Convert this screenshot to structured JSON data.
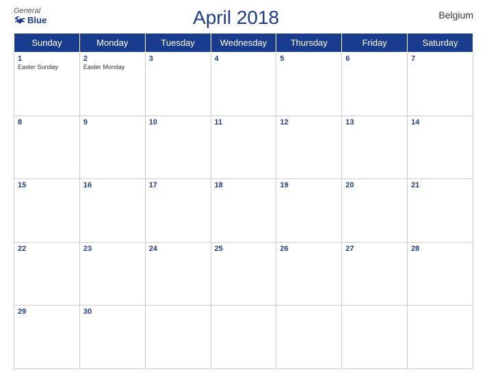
{
  "header": {
    "logo_general": "General",
    "logo_blue": "Blue",
    "title": "April 2018",
    "country": "Belgium"
  },
  "days_of_week": [
    "Sunday",
    "Monday",
    "Tuesday",
    "Wednesday",
    "Thursday",
    "Friday",
    "Saturday"
  ],
  "weeks": [
    [
      {
        "day": "1",
        "holiday": "Easter Sunday"
      },
      {
        "day": "2",
        "holiday": "Easter Monday"
      },
      {
        "day": "3",
        "holiday": ""
      },
      {
        "day": "4",
        "holiday": ""
      },
      {
        "day": "5",
        "holiday": ""
      },
      {
        "day": "6",
        "holiday": ""
      },
      {
        "day": "7",
        "holiday": ""
      }
    ],
    [
      {
        "day": "8",
        "holiday": ""
      },
      {
        "day": "9",
        "holiday": ""
      },
      {
        "day": "10",
        "holiday": ""
      },
      {
        "day": "11",
        "holiday": ""
      },
      {
        "day": "12",
        "holiday": ""
      },
      {
        "day": "13",
        "holiday": ""
      },
      {
        "day": "14",
        "holiday": ""
      }
    ],
    [
      {
        "day": "15",
        "holiday": ""
      },
      {
        "day": "16",
        "holiday": ""
      },
      {
        "day": "17",
        "holiday": ""
      },
      {
        "day": "18",
        "holiday": ""
      },
      {
        "day": "19",
        "holiday": ""
      },
      {
        "day": "20",
        "holiday": ""
      },
      {
        "day": "21",
        "holiday": ""
      }
    ],
    [
      {
        "day": "22",
        "holiday": ""
      },
      {
        "day": "23",
        "holiday": ""
      },
      {
        "day": "24",
        "holiday": ""
      },
      {
        "day": "25",
        "holiday": ""
      },
      {
        "day": "26",
        "holiday": ""
      },
      {
        "day": "27",
        "holiday": ""
      },
      {
        "day": "28",
        "holiday": ""
      }
    ],
    [
      {
        "day": "29",
        "holiday": ""
      },
      {
        "day": "30",
        "holiday": ""
      },
      {
        "day": "",
        "holiday": ""
      },
      {
        "day": "",
        "holiday": ""
      },
      {
        "day": "",
        "holiday": ""
      },
      {
        "day": "",
        "holiday": ""
      },
      {
        "day": "",
        "holiday": ""
      }
    ]
  ]
}
